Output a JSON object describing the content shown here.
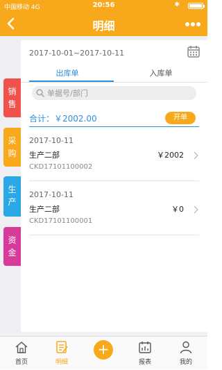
{
  "status_bar": {
    "carrier": "中国移动  4G",
    "time": "20:56"
  },
  "nav": {
    "title": "明细",
    "back_icon": "chevron-left-icon",
    "more_icon": "more-dots-icon"
  },
  "filter": {
    "date_range": "2017-10-01~2017-10-11",
    "calendar_icon": "calendar-icon"
  },
  "tabs": [
    {
      "label": "出库单",
      "active": true
    },
    {
      "label": "入库单",
      "active": false
    }
  ],
  "search": {
    "placeholder": "单据号/部门"
  },
  "summary": {
    "total_label": "合计：￥2002.00",
    "open_button": "开单"
  },
  "records": [
    {
      "date": "2017-10-11",
      "department": "生产二部",
      "amount": "￥2002",
      "code": "CKD17101100002"
    },
    {
      "date": "2017-10-11",
      "department": "生产二部",
      "amount": "￥0",
      "code": "CKD17101100001"
    }
  ],
  "side_tabs": [
    {
      "label": "销售",
      "color": "#f0524b"
    },
    {
      "label": "采购",
      "color": "#f7a81b"
    },
    {
      "label": "生产",
      "color": "#2aa7e6",
      "active": true
    },
    {
      "label": "资金",
      "color": "#d83a9a"
    }
  ],
  "tab_bar": {
    "items": [
      {
        "label": "首页",
        "icon": "home-icon"
      },
      {
        "label": "明细",
        "icon": "document-edit-icon",
        "active": true
      },
      {
        "label": "+",
        "icon": "plus-icon"
      },
      {
        "label": "报表",
        "icon": "calendar-chart-icon"
      },
      {
        "label": "我的",
        "icon": "user-icon"
      }
    ]
  },
  "colors": {
    "brand": "#f7a81b",
    "accent": "#2b8fe0"
  }
}
